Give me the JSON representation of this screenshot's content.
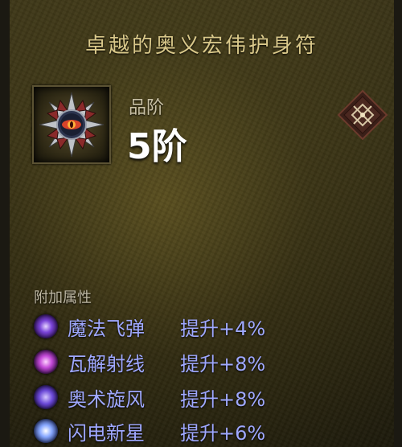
{
  "item": {
    "name": "卓越的奥义宏伟护身符",
    "tier_label": "品阶",
    "tier_value": "5阶",
    "icon": "amulet-icon",
    "slot_icon": "amulet-slot-icon"
  },
  "affixes": {
    "header": "附加属性",
    "items": [
      {
        "icon": "magic-missile-icon",
        "name": "魔法飞弹",
        "bonus": "提升+4%"
      },
      {
        "icon": "disintegrate-icon",
        "name": "瓦解射线",
        "bonus": "提升+8%"
      },
      {
        "icon": "arcane-torrent-icon",
        "name": "奥术旋风",
        "bonus": "提升+8%"
      },
      {
        "icon": "frost-nova-icon",
        "name": "闪电新星",
        "bonus": "提升+6%"
      }
    ]
  },
  "colors": {
    "title": "#d9c88a",
    "affix_text": "#9fa8ff",
    "tier_value": "#ffffff"
  }
}
